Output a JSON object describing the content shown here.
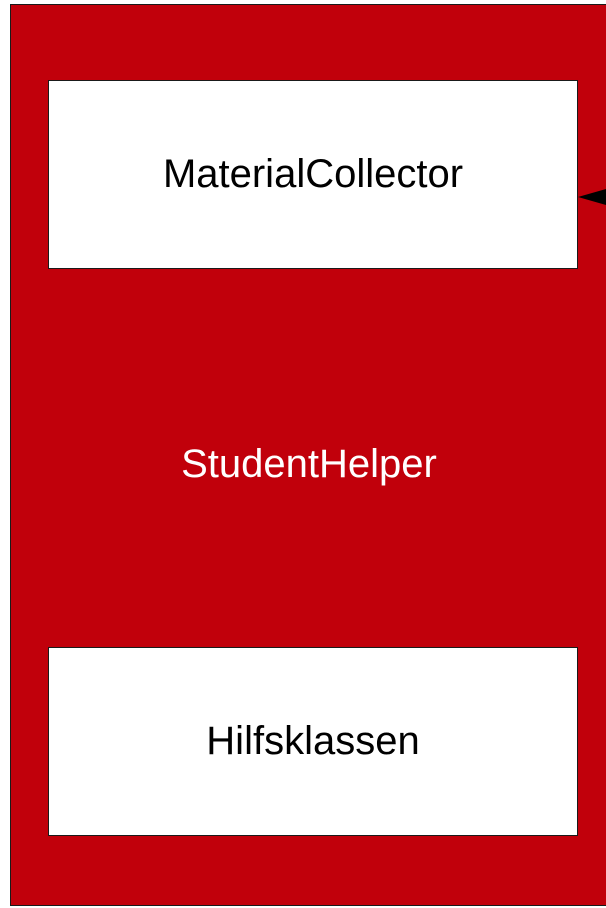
{
  "diagram": {
    "container": {
      "label": "StudentHelper",
      "fill": "#c1000b",
      "text_color": "#ffffff"
    },
    "boxes": [
      {
        "label": "MaterialCollector",
        "fill": "#ffffff"
      },
      {
        "label": "Hilfsklassen",
        "fill": "#ffffff"
      }
    ],
    "connector": {
      "target": "MaterialCollector",
      "arrowhead": "filled-triangle",
      "color": "#000000"
    }
  }
}
